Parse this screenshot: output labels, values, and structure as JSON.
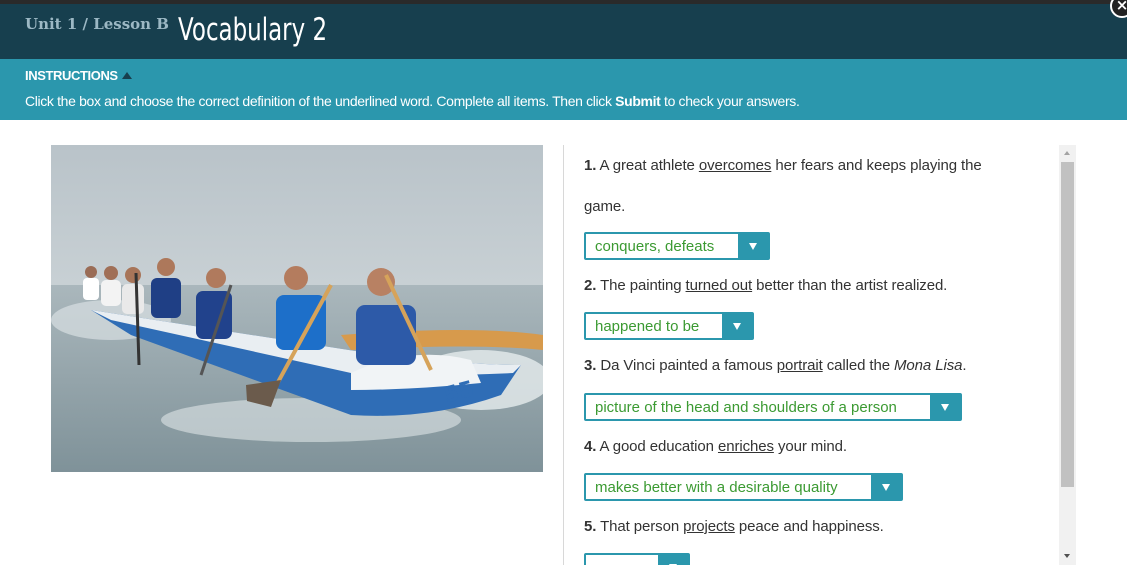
{
  "header": {
    "unit_lesson": "Unit 1 / Lesson B",
    "title": "Vocabulary 2",
    "close_icon": "close-icon"
  },
  "instructions": {
    "toggle_label": "INSTRUCTIONS",
    "text_before": "Click the box and choose the correct definition of the underlined word. Complete all items. Then click ",
    "text_bold": "Submit",
    "text_after": " to check your answers."
  },
  "photo": {
    "alt": "outrigger-canoe-rowers-photo"
  },
  "questions": [
    {
      "number": "1.",
      "before": " A great athlete ",
      "word": "overcomes",
      "after": " her fears and keeps playing the",
      "continuation": "game.",
      "selected": "conquers, defeats"
    },
    {
      "number": "2.",
      "before": " The painting ",
      "word": "turned out",
      "after": " better than the artist realized.",
      "selected": "happened to be"
    },
    {
      "number": "3.",
      "before": " Da Vinci painted a famous ",
      "word": "portrait",
      "after": " called the ",
      "italic": "Mona Lisa",
      "end": ".",
      "selected": "picture of the head and shoulders of a person"
    },
    {
      "number": "4.",
      "before": " A good education ",
      "word": "enriches",
      "after": " your mind.",
      "selected": "makes better with a desirable quality"
    },
    {
      "number": "5.",
      "before": " That person ",
      "word": "projects",
      "after": " peace and happiness.",
      "selected": ""
    }
  ],
  "colors": {
    "header_bg": "#173f4e",
    "instructions_bg": "#2b97ad",
    "accent": "#2b97ad",
    "answer_text": "#3b9a32"
  }
}
